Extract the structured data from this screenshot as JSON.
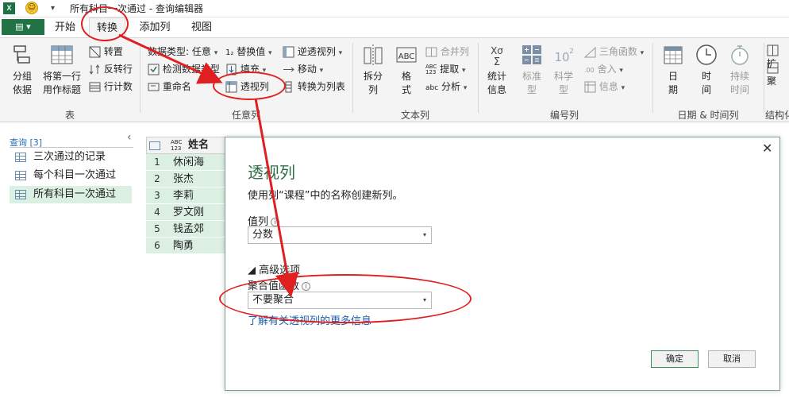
{
  "titlebar": {
    "title": "所有科目一次通过 - 查询编辑器",
    "app_icon": "excel-icon",
    "xl_text": "X",
    "smile_glyph": "☺",
    "dropdown_glyph": "▾"
  },
  "tabs": {
    "file_label": "▤ ▾",
    "items": [
      "开始",
      "转换",
      "添加列",
      "视图"
    ]
  },
  "ribbon": {
    "groups": {
      "table": {
        "label": "表",
        "group_by": [
          "分组",
          "依据"
        ],
        "first_row_header": [
          "将第一行",
          "用作标题"
        ],
        "transpose": "转置",
        "reverse_rows": "反转行",
        "count_rows": "行计数"
      },
      "any_column": {
        "label": "任意列",
        "data_type": "数据类型: 任意",
        "detect_type": "检测数据类型",
        "rename": "重命名",
        "replace_values": "替换值",
        "fill": "填充",
        "pivot": "透视列",
        "unpivot": "逆透视列",
        "move": "移动",
        "to_list": "转换为列表"
      },
      "text_column": {
        "label": "文本列",
        "split": [
          "拆分",
          "列"
        ],
        "format": [
          "格",
          "式"
        ],
        "merge": "合并列",
        "extract": "提取",
        "parse": "分析"
      },
      "number_column": {
        "label": "编号列",
        "statistics": [
          "统计",
          "信息"
        ],
        "standard": [
          "标准",
          "型"
        ],
        "scientific": [
          "科学",
          "型"
        ],
        "trig": "三角函数",
        "rounding": "舍入",
        "information": "信息"
      },
      "datetime_column": {
        "label": "日期 & 时间列",
        "date": [
          "日",
          "期"
        ],
        "time": [
          "时",
          "间"
        ],
        "duration": [
          "持续",
          "时间"
        ]
      },
      "structured": {
        "label": "结构化",
        "expand": "扩",
        "aggregate": "聚"
      }
    }
  },
  "nav": {
    "header": "查询 [3]",
    "collapse_glyph": "‹",
    "items": [
      "三次通过的记录",
      "每个科目一次通过",
      "所有科目一次通过"
    ]
  },
  "grid": {
    "type_badge": "ABC\n123",
    "column_header": "姓名",
    "rows": [
      {
        "n": "1",
        "v": "休闲海"
      },
      {
        "n": "2",
        "v": "张杰"
      },
      {
        "n": "3",
        "v": "李莉"
      },
      {
        "n": "4",
        "v": "罗文刚"
      },
      {
        "n": "5",
        "v": "钱孟郊"
      },
      {
        "n": "6",
        "v": "陶勇"
      }
    ]
  },
  "dialog": {
    "title": "透视列",
    "close_glyph": "✕",
    "description": "使用列“课程”中的名称创建新列。",
    "values_column_label": "值列",
    "values_column_value": "分数",
    "advanced_toggle": "◢ 高级选项",
    "agg_label": "聚合值函数",
    "agg_value": "不要聚合",
    "info_glyph": "i",
    "caret_glyph": "▾",
    "link": "了解有关透视列的更多信息",
    "ok": "确定",
    "cancel": "取消"
  },
  "colors": {
    "accent_green": "#217346",
    "annotation_red": "#e02020",
    "selected_row": "#dcefe3"
  }
}
